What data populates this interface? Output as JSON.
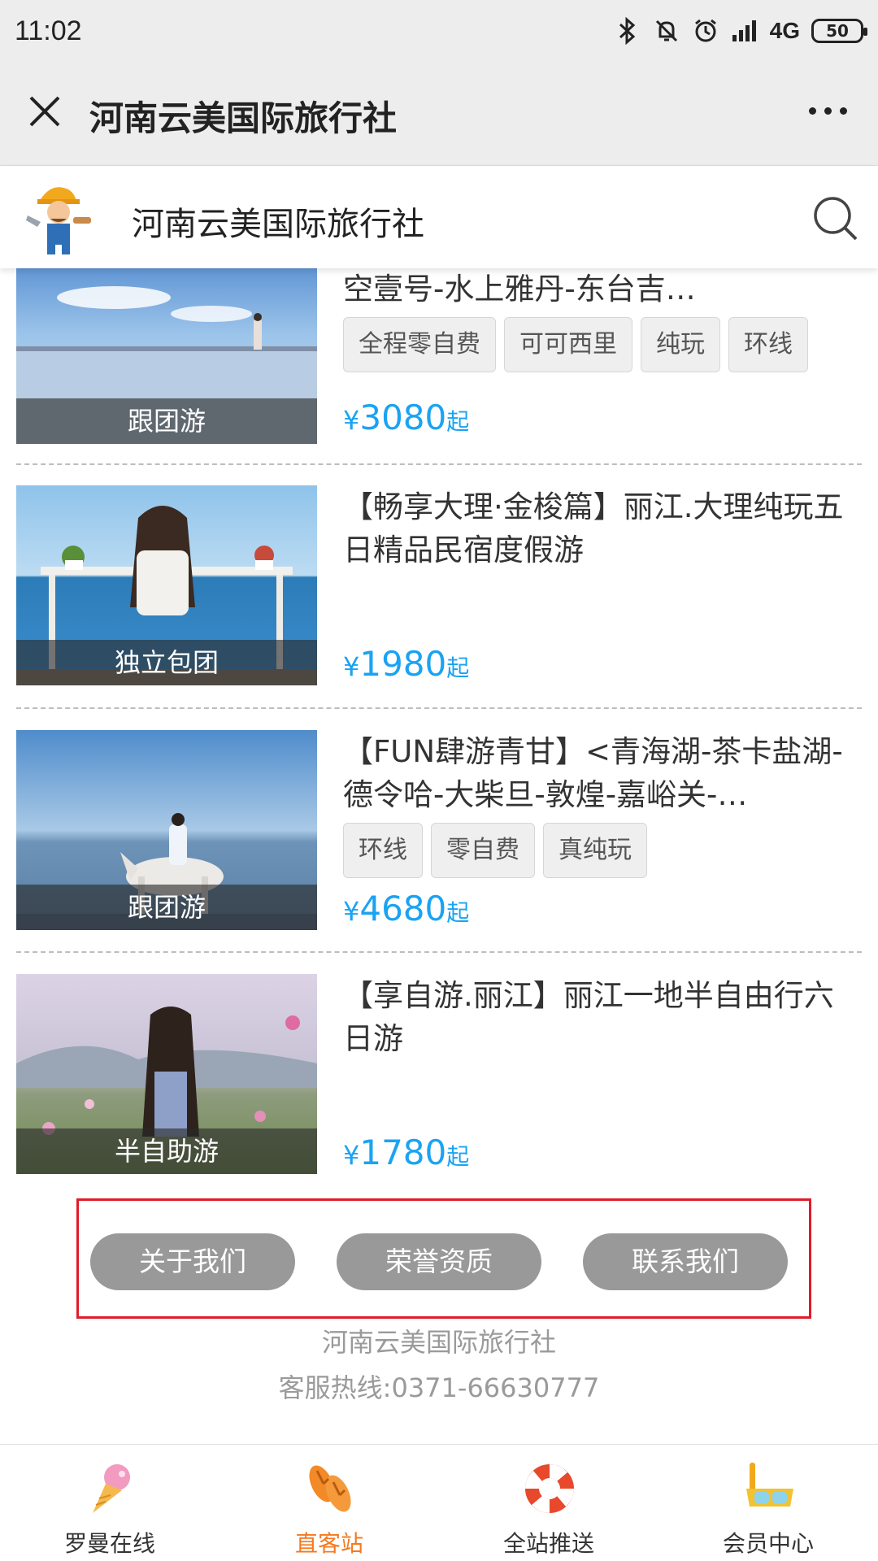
{
  "status_bar": {
    "time": "11:02",
    "network": "4G",
    "battery": "50"
  },
  "titlebar": {
    "title": "河南云美国际旅行社"
  },
  "site_header": {
    "name": "河南云美国际旅行社"
  },
  "products": [
    {
      "title": "【仙境哥可西里】<门源-草原山茶卡天空壹号-水上雅丹-东台吉…",
      "category": "跟团游",
      "tags": [
        "全程零自费",
        "可可西里",
        "纯玩",
        "环线"
      ],
      "price_symbol": "¥",
      "price": "3080",
      "price_suffix": "起"
    },
    {
      "title": "【畅享大理·金梭篇】丽江.大理纯玩五日精品民宿度假游",
      "category": "独立包团",
      "tags": [],
      "price_symbol": "¥",
      "price": "1980",
      "price_suffix": "起"
    },
    {
      "title": "【FUN肆游青甘】<青海湖-茶卡盐湖-德令哈-大柴旦-敦煌-嘉峪关-…",
      "category": "跟团游",
      "tags": [
        "环线",
        "零自费",
        "真纯玩"
      ],
      "price_symbol": "¥",
      "price": "4680",
      "price_suffix": "起"
    },
    {
      "title": "【享自游.丽江】丽江一地半自由行六日游",
      "category": "半自助游",
      "tags": [],
      "price_symbol": "¥",
      "price": "1780",
      "price_suffix": "起"
    }
  ],
  "footer": {
    "links": [
      "关于我们",
      "荣誉资质",
      "联系我们"
    ],
    "company": "河南云美国际旅行社",
    "hotline": "客服热线:0371-66630777"
  },
  "bottom_nav": [
    {
      "label": "罗曼在线",
      "icon": "ice-cream-icon"
    },
    {
      "label": "直客站",
      "icon": "flip-flops-icon",
      "active": true
    },
    {
      "label": "全站推送",
      "icon": "lifebuoy-icon"
    },
    {
      "label": "会员中心",
      "icon": "snorkel-mask-icon"
    }
  ],
  "colors": {
    "price": "#1aa3f2",
    "active_tab": "#f47a1f",
    "highlight_box": "#e11b2a",
    "pill": "#999999"
  }
}
